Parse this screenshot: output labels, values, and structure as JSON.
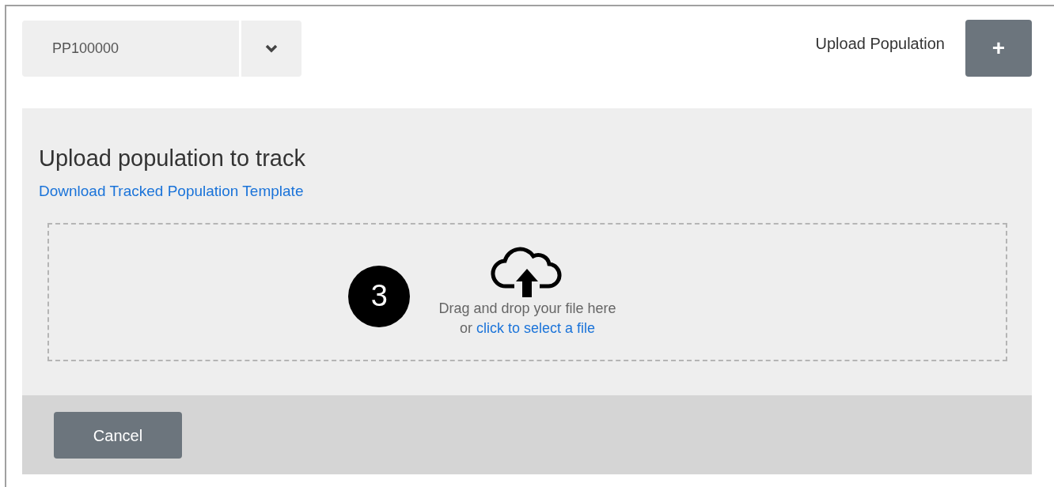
{
  "selector": {
    "value": "PP100000"
  },
  "header_action": {
    "label": "Upload Population",
    "button": "+"
  },
  "panel": {
    "title": "Upload population to track",
    "template_link": "Download Tracked Population Template",
    "dropzone": {
      "callout": "3",
      "text": "Drag and drop your file here",
      "prefix": "or",
      "link": "click to select a file"
    }
  },
  "footer": {
    "buttons": [
      "Cancel"
    ]
  }
}
